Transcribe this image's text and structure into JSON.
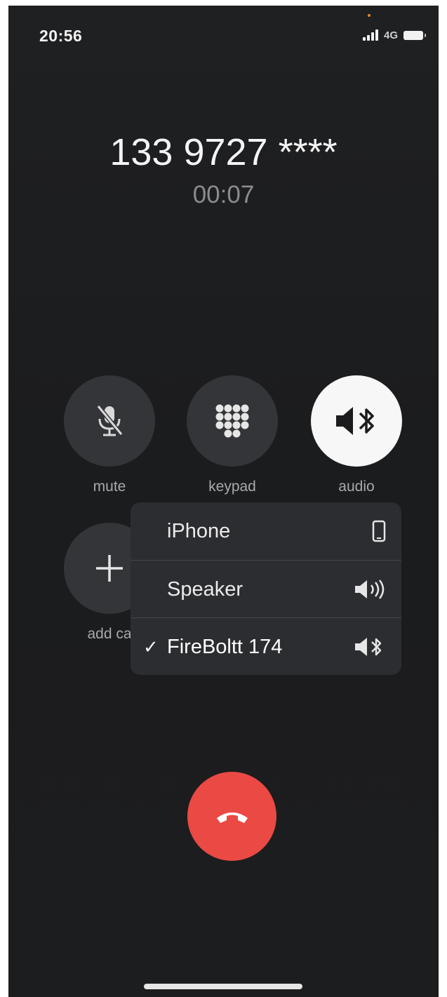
{
  "status_bar": {
    "time": "20:56",
    "network": "4G",
    "icons": [
      "signal-icon",
      "battery-icon"
    ]
  },
  "call": {
    "number": "133 9727 ****",
    "duration": "00:07"
  },
  "controls": {
    "mute_label": "mute",
    "keypad_label": "keypad",
    "audio_label": "audio",
    "add_call_label": "add ca",
    "icons": [
      "mic-off-icon",
      "keypad-grid-icon",
      "bluetooth-speaker-icon",
      "plus-icon"
    ]
  },
  "audio_menu": {
    "items": [
      {
        "label": "iPhone",
        "icon": "iphone-icon",
        "selected": false
      },
      {
        "label": "Speaker",
        "icon": "speaker-icon",
        "selected": false
      },
      {
        "label": "FireBoltt 174",
        "icon": "bluetooth-speaker-icon",
        "selected": true
      }
    ],
    "check_mark": "✓"
  },
  "end_call": {
    "icon": "hang-up-icon"
  },
  "colors": {
    "background": "#1d1e20",
    "end_call_red": "#ea4a43",
    "active_button": "#f7f7f7"
  }
}
